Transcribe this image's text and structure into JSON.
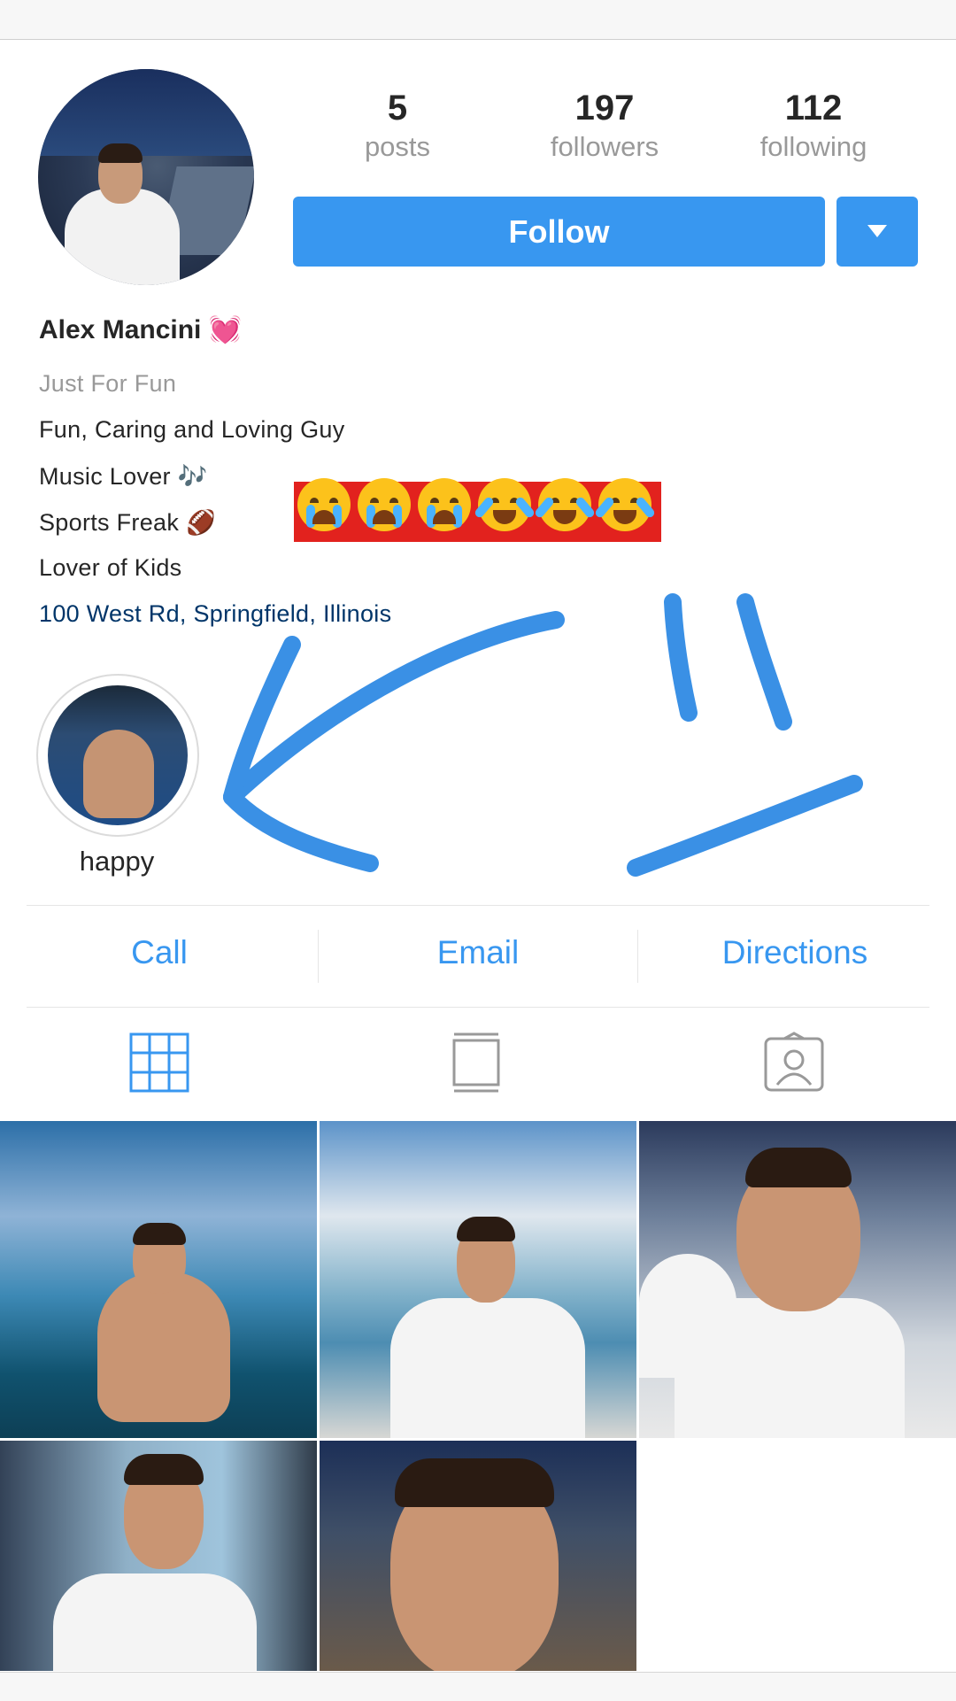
{
  "profile": {
    "name": "Alex Mancini",
    "name_emoji": "💓",
    "category": "Just For Fun",
    "bio_lines": [
      "Fun, Caring and Loving Guy",
      "Music Lover 🎶",
      "Sports Freak 🏈",
      "Lover of Kids"
    ],
    "address": "100 West Rd, Springfield, Illinois"
  },
  "stats": {
    "posts": {
      "value": "5",
      "label": "posts"
    },
    "followers": {
      "value": "197",
      "label": "followers"
    },
    "following": {
      "value": "112",
      "label": "following"
    }
  },
  "actions": {
    "follow_label": "Follow"
  },
  "highlight": {
    "label": "happy"
  },
  "contact": {
    "call": "Call",
    "email": "Email",
    "directions": "Directions"
  },
  "tabs": [
    {
      "icon": "grid-icon",
      "active": true
    },
    {
      "icon": "feed-icon",
      "active": false
    },
    {
      "icon": "tagged-icon",
      "active": false
    }
  ],
  "overlay": {
    "emoji_row": [
      "crying-face",
      "crying-face",
      "crying-face",
      "laughing-tears-face",
      "laughing-tears-face",
      "laughing-tears-face"
    ],
    "drawing": "blue-arrow-and-smiley-face"
  },
  "colors": {
    "accent": "#3897f0",
    "link": "#003569",
    "annotation": "#3a90e5",
    "emoji_highlight": "#e2221e"
  }
}
